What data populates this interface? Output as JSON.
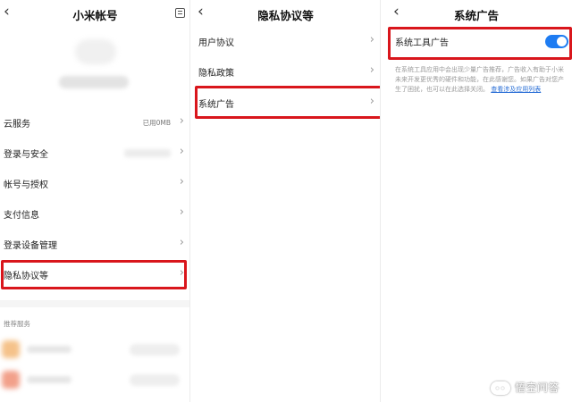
{
  "panel_account": {
    "title": "小米帐号",
    "back_icon": "‹",
    "cloud_storage_value": "已用0MB",
    "menu": [
      {
        "label": "云服务"
      },
      {
        "label": "登录与安全"
      },
      {
        "label": "帐号与授权"
      },
      {
        "label": "支付信息"
      },
      {
        "label": "登录设备管理"
      },
      {
        "label": "隐私协议等"
      }
    ],
    "recommend_header": "推荐服务",
    "chevron": "›"
  },
  "panel_privacy": {
    "title": "隐私协议等",
    "back_icon": "‹",
    "menu": [
      {
        "label": "用户协议"
      },
      {
        "label": "隐私政策"
      },
      {
        "label": "系统广告"
      }
    ],
    "chevron": "›"
  },
  "panel_ads": {
    "title": "系统广告",
    "back_icon": "‹",
    "toggle_label": "系统工具广告",
    "toggle_on": true,
    "description": "在系统工具应用中会出现少量广告推荐，广告收入有助于小米未来开发更优秀的硬件和功能，在此感谢您。如果广告对您产生了困扰，也可以在此选择关闭。",
    "link_text": "查看涉及应用列表"
  },
  "colors": {
    "highlight": "#d9161c",
    "toggle_on": "#1e7cf2",
    "link": "#2a6fd6"
  },
  "watermark": {
    "text": "悟空问答"
  }
}
